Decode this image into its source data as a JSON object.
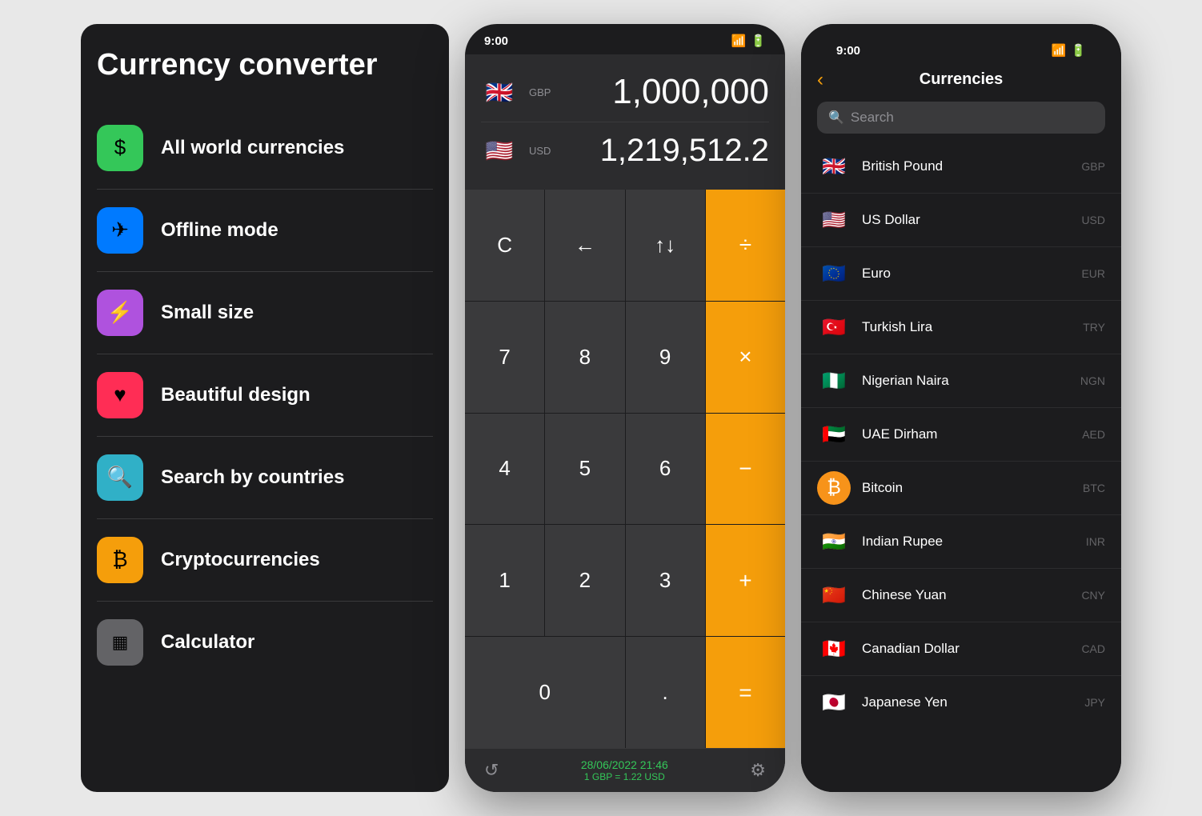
{
  "features": {
    "title": "Currency converter",
    "items": [
      {
        "id": "all-currencies",
        "label": "All world currencies",
        "icon": "$",
        "iconClass": "icon-green"
      },
      {
        "id": "offline-mode",
        "label": "Offline mode",
        "icon": "✈",
        "iconClass": "icon-blue"
      },
      {
        "id": "small-size",
        "label": "Small size",
        "icon": "⚡",
        "iconClass": "icon-purple"
      },
      {
        "id": "beautiful-design",
        "label": "Beautiful design",
        "icon": "♥",
        "iconClass": "icon-pink"
      },
      {
        "id": "search-countries",
        "label": "Search by countries",
        "icon": "🔍",
        "iconClass": "icon-teal"
      },
      {
        "id": "crypto",
        "label": "Cryptocurrencies",
        "icon": "₿",
        "iconClass": "icon-orange"
      },
      {
        "id": "calculator",
        "label": "Calculator",
        "icon": "▦",
        "iconClass": "icon-gray"
      }
    ]
  },
  "calculator": {
    "status_time": "9:00",
    "from_currency": "GBP",
    "from_flag": "🇬🇧",
    "from_amount": "1,000,000",
    "to_currency": "USD",
    "to_flag": "🇺🇸",
    "to_amount": "1,219,512.2",
    "keys": [
      "C",
      "←",
      "↑↓",
      "÷",
      "7",
      "8",
      "9",
      "×",
      "4",
      "5",
      "6",
      "−",
      "1",
      "2",
      "3",
      "+",
      "0",
      ".",
      "="
    ],
    "date": "28/06/2022 21:46",
    "rate": "1 GBP = 1.22 USD"
  },
  "currencies": {
    "status_time": "9:00",
    "title": "Currencies",
    "search_placeholder": "Search",
    "back_label": "‹",
    "items": [
      {
        "name": "British Pound",
        "code": "GBP",
        "flag": "🇬🇧"
      },
      {
        "name": "US Dollar",
        "code": "USD",
        "flag": "🇺🇸"
      },
      {
        "name": "Euro",
        "code": "EUR",
        "flag": "🇪🇺"
      },
      {
        "name": "Turkish Lira",
        "code": "TRY",
        "flag": "🇹🇷"
      },
      {
        "name": "Nigerian Naira",
        "code": "NGN",
        "flag": "🇳🇬"
      },
      {
        "name": "UAE Dirham",
        "code": "AED",
        "flag": "🇦🇪"
      },
      {
        "name": "Bitcoin",
        "code": "BTC",
        "flag": "₿"
      },
      {
        "name": "Indian Rupee",
        "code": "INR",
        "flag": "🇮🇳"
      },
      {
        "name": "Chinese Yuan",
        "code": "CNY",
        "flag": "🇨🇳"
      },
      {
        "name": "Canadian Dollar",
        "code": "CAD",
        "flag": "🇨🇦"
      },
      {
        "name": "Japanese Yen",
        "code": "JPY",
        "flag": "🇯🇵"
      }
    ]
  }
}
